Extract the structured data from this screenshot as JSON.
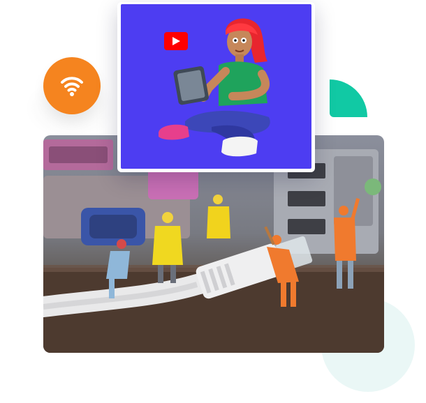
{
  "colors": {
    "accent_orange": "#f5841f",
    "accent_teal": "#11c9a4",
    "soft_teal": "#eaf7f6",
    "video_background": "#4d3df2",
    "youtube_red": "#ff0000"
  },
  "icons": {
    "wifi_badge": "wifi-icon",
    "video_app": "youtube-icon"
  }
}
